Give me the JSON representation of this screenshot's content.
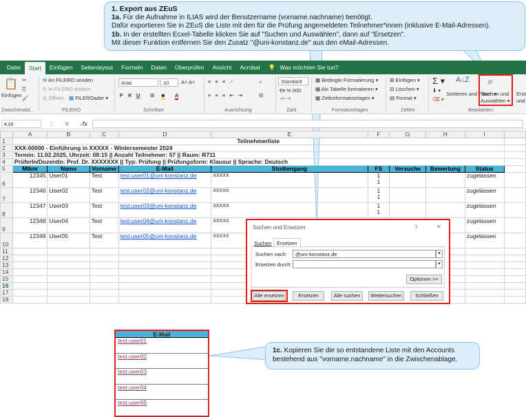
{
  "callout_top": {
    "heading": "1. Export aus ZEuS",
    "step_1a_label": "1a.",
    "step_1a_text": " Für die Aufnahme in ILIAS wird der Benutzername (vorname.nachname) benötigt.",
    "line2": "Dafür exportieren Sie in ZEuS die Liste mit den für die Prüfung angemeldeten Teilnehmer*innen (inklusive E-Mail-Adressen).",
    "step_1b_label": "1b.",
    "step_1b_text": " In der erstellten Ecxel-Tabelle klicken Sie auf \"Suchen und Auswählen\", dann auf \"Ersetzen\".",
    "line4": "Mit dieser Funktion entfernen Sie den Zusatz \"@uni-konstanz.de\" aus den eMail-Adressen."
  },
  "ribbon_tabs": [
    "Datei",
    "Start",
    "Einfügen",
    "Seitenlayout",
    "Formeln",
    "Daten",
    "Überprüfen",
    "Ansicht",
    "Acrobat",
    "Was möchten Sie tun?"
  ],
  "ribbon": {
    "paste_label": "Einfügen",
    "filero_send": "An FILERO senden",
    "filero_change": "In FILERO ändern",
    "filero_open": "Öffnen",
    "filero_loader": "FILEROader",
    "clipboard_group": "Zwischenabl...",
    "filero_group": "FILERO",
    "font_name": "Arial",
    "font_size": "10",
    "font_group": "Schriftart",
    "align_group": "Ausrichtung",
    "number_format": "Standard",
    "number_group": "Zahl",
    "cond_format": "Bedingte Formatierung",
    "table_format": "Als Tabelle formatieren",
    "cell_styles": "Zellenformatvorlagen",
    "styles_group": "Formatvorlagen",
    "cells_insert": "Einfügen",
    "cells_delete": "Löschen",
    "cells_format": "Format",
    "cells_group": "Zellen",
    "sort_filter": "Sortieren und Filtern",
    "find_select_1": "Suchen und",
    "find_select_2": "Auswählen",
    "edit_group": "Bearbeiten",
    "next_1": "Erste",
    "next_2": "und"
  },
  "formula_bar": {
    "cell_ref": "K16",
    "fx": "fx",
    "value": ""
  },
  "columns": [
    "A",
    "B",
    "C",
    "D",
    "E",
    "F",
    "G",
    "H",
    "I"
  ],
  "sheet": {
    "title": "Teilnehmerliste",
    "row2": "XXX-00000 - Einführung in XXXXX  -  Wintersemester 2024",
    "row3": "Termin: 11.02.2025, Uhrzeit: 08:15 || Anzahl Teilnehmer: 57 || Raum: R711",
    "row4": "PrüferIn/DozentIn: Prof. Dr. XXXXXXX  || Typ: Prüfung || Prüfungsform: Klausur || Sprache: Deutsch",
    "headers": [
      "Mtknr",
      "Name",
      "Vorname",
      "E-Mail",
      "Studiengang",
      "FS",
      "Versuche",
      "Bewertung",
      "Status"
    ],
    "rows": [
      {
        "rownum": "6",
        "mtknr": "12345",
        "name": "User01",
        "vorname": "Test",
        "email": "test.user01@uni-konstanz.de",
        "studiengang": "XXXXX",
        "fs": "1",
        "fs2": "1",
        "status": "zugelassen"
      },
      {
        "rownum": "7",
        "mtknr": "12346",
        "name": "User02",
        "vorname": "Test",
        "email": "test.user02@uni-konstanz.de",
        "studiengang": "XXXXX",
        "fs": "1",
        "fs2": "1",
        "status": "zugelassen"
      },
      {
        "rownum": "8",
        "mtknr": "12347",
        "name": "User03",
        "vorname": "Test",
        "email": "test.user03@uni-konstanz.de",
        "studiengang": "XXXXX",
        "fs": "1",
        "fs2": "1",
        "status": "zugelassen"
      },
      {
        "rownum": "9",
        "mtknr": "12348",
        "name": "User04",
        "vorname": "Test",
        "email": "test.user04@uni-konstanz.de",
        "studiengang": "XXXXX",
        "fs": "1",
        "fs2": "",
        "status": "zugelassen"
      },
      {
        "rownum": "10",
        "mtknr": "12349",
        "name": "User05",
        "vorname": "Test",
        "email": "test.user05@uni-konstanz.de",
        "studiengang": "XXXXX",
        "fs": "",
        "fs2": "",
        "status": "zugelassen"
      }
    ],
    "empty_rows": [
      "11",
      "12",
      "13",
      "14",
      "15",
      "16",
      "17",
      "18"
    ],
    "top_rows": [
      "1",
      "2",
      "3",
      "4",
      "5"
    ]
  },
  "dialog": {
    "title": "Suchen und Ersetzen",
    "help": "?",
    "close": "✕",
    "tab_find": "Suchen",
    "tab_replace": "Ersetzen",
    "find_label": "Suchen nach:",
    "find_value": "@uni-konstanz.de",
    "replace_label": "Ersetzen durch:",
    "replace_value": "",
    "options_btn": "Optionen >>",
    "btn_replace_all": "Alle ersetzen",
    "btn_replace": "Ersetzen",
    "btn_find_all": "Alle suchen",
    "btn_find_next": "Weitersuchen",
    "btn_close": "Schließen"
  },
  "lower_table": {
    "header": "E-Mail",
    "items": [
      "test.user01",
      "test.user02",
      "test.user03",
      "test.user04",
      "test.user05"
    ]
  },
  "callout_bottom": {
    "label": "1c.",
    "text": " Kopieren Sie die so entstandene Liste mit den Accounts bestehend aus \"vorname.nachname\" in die Zwischenablage."
  },
  "colors": {
    "excel_green": "#217346",
    "header_blue": "#4ab3d9",
    "highlight_red": "#e21b1b",
    "callout_bg": "#dbeef9"
  }
}
